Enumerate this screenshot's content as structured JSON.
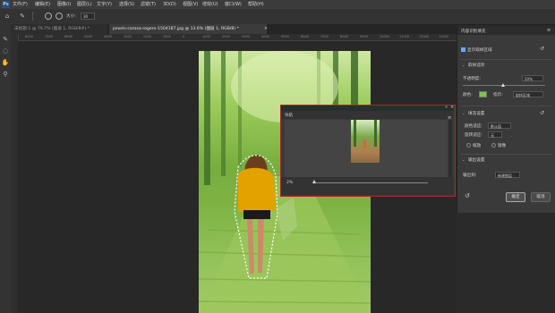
{
  "menubar": {
    "app_logo": "Ps",
    "items": [
      "文件(F)",
      "编辑(E)",
      "图像(I)",
      "图层(L)",
      "文字(Y)",
      "选择(S)",
      "滤镜(T)",
      "3D(D)",
      "视图(V)",
      "增效(U)",
      "窗口(W)",
      "帮助(H)"
    ]
  },
  "options": {
    "size_label": "大小:",
    "size_value": "30"
  },
  "tabs": [
    {
      "label": "未标题-1 @ 79.7% (图层 1, RGB/8#) *",
      "active": false
    },
    {
      "label": "pexels-caroxa-rogero-1504187.jpg @ 13.6% (图层 1, RGB/8) *",
      "active": true
    }
  ],
  "ruler": {
    "top_ticks": [
      "8000",
      "7000",
      "6000",
      "5000",
      "4000",
      "3000",
      "2000",
      "1000",
      "0",
      "1000",
      "2000",
      "3000",
      "4000",
      "5000",
      "6000",
      "7000",
      "8000",
      "9000",
      "10000",
      "11000",
      "12000",
      "13000"
    ]
  },
  "navigator": {
    "title": "导航",
    "zoom": "2%"
  },
  "fill_panel": {
    "title": "内容识别填充",
    "show_sample_label": "显示取样区域",
    "sample_options_header": "取样选项",
    "opacity_label": "不透明度:",
    "opacity_value": "50%",
    "color_label": "颜色:",
    "indicate_label": "指示:",
    "indicate_value": "取样区域",
    "fill_settings_header": "填充设置",
    "color_adapt_label": "颜色适应:",
    "color_adapt_value": "默认值",
    "rotate_adapt_label": "旋转适应:",
    "rotate_adapt_value": "无",
    "scale_label": "缩放",
    "mirror_label": "镜像",
    "output_settings_header": "输出设置",
    "output_to_label": "输出到:",
    "output_to_value": "新建图层",
    "ok_label": "确定",
    "cancel_label": "取消"
  },
  "colors": {
    "sample_swatch": "#7cc443",
    "accent": "#b32424"
  }
}
